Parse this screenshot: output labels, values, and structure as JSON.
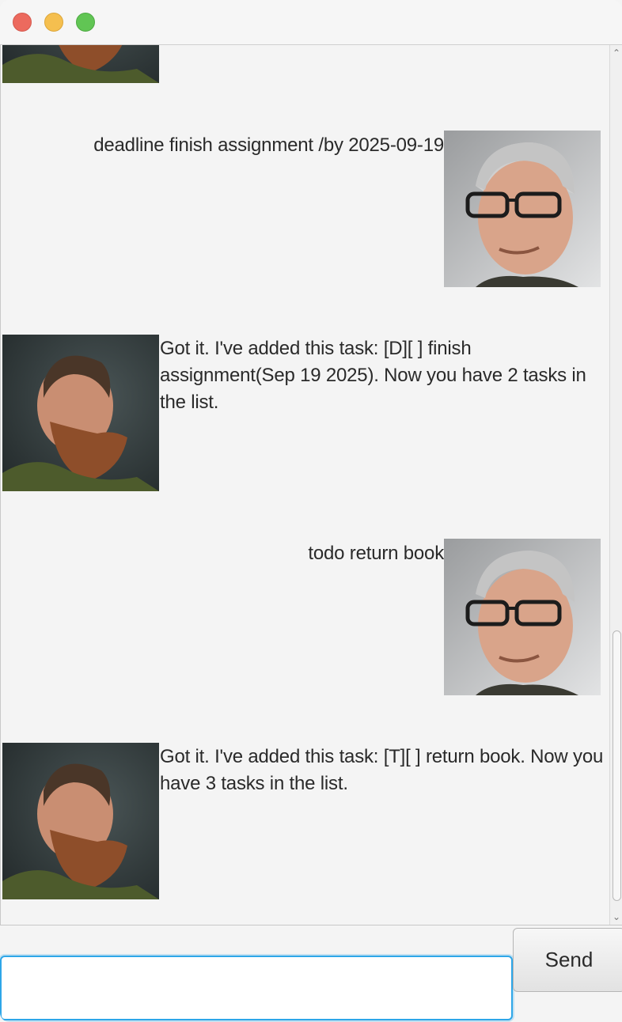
{
  "window": {
    "controls": [
      "close",
      "minimize",
      "maximize"
    ]
  },
  "chat": {
    "messages": [
      {
        "sender": "user",
        "text": "deadline finish assignment /by 2025-09-19"
      },
      {
        "sender": "bot",
        "text": "Got it. I've added this task: [D][ ] finish assignment(Sep 19 2025). Now you have 2 tasks in the list."
      },
      {
        "sender": "user",
        "text": "todo return book"
      },
      {
        "sender": "bot",
        "text": "Got it. I've added this task: [T][ ] return book. Now you have 3 tasks in the list."
      }
    ]
  },
  "input": {
    "value": "",
    "placeholder": ""
  },
  "send_button": {
    "label": "Send"
  },
  "colors": {
    "background": "#f4f4f4",
    "input_focus": "#2ea6e8"
  }
}
